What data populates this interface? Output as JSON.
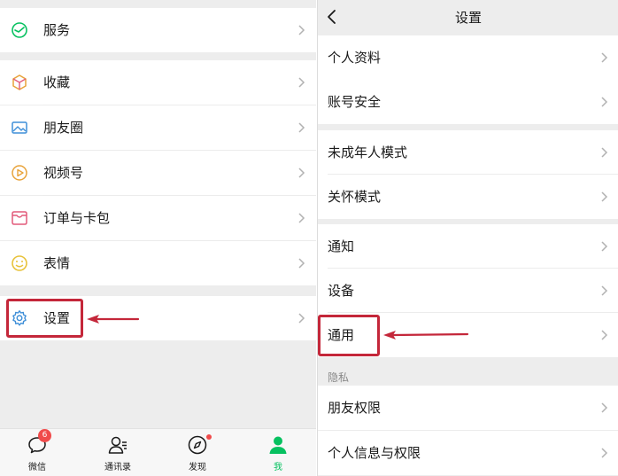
{
  "left_menu": {
    "services": "服务",
    "favorites": "收藏",
    "moments": "朋友圈",
    "channels": "视频号",
    "orders": "订单与卡包",
    "stickers": "表情",
    "settings": "设置"
  },
  "tabbar": {
    "chats": "微信",
    "chats_badge": "6",
    "contacts": "通讯录",
    "discover": "发现",
    "me": "我"
  },
  "settings_page": {
    "title": "设置",
    "items": {
      "profile": "个人资料",
      "account_security": "账号安全",
      "minor_mode": "未成年人模式",
      "care_mode": "关怀模式",
      "notifications": "通知",
      "devices": "设备",
      "general": "通用",
      "privacy_section": "隐私",
      "friend_permissions": "朋友权限",
      "personal_info_permissions": "个人信息与权限"
    }
  },
  "colors": {
    "highlight": "#c4273a",
    "accent_green": "#07c160",
    "badge_red": "#f04b4b",
    "background_gray": "#ededed"
  }
}
